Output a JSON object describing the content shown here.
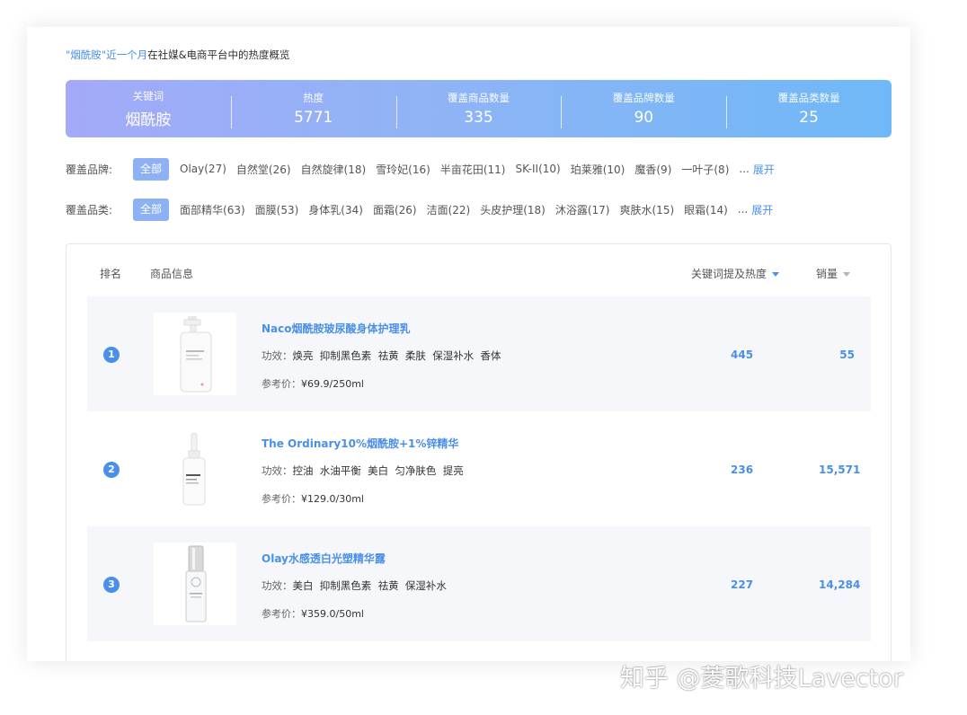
{
  "heading": {
    "keyword": "\"烟酰胺\"近一个月",
    "rest": "在社媒&电商平台中的热度概览"
  },
  "stats": [
    {
      "label": "关键词",
      "value": "烟酰胺"
    },
    {
      "label": "热度",
      "value": "5771"
    },
    {
      "label": "覆盖商品数量",
      "value": "335"
    },
    {
      "label": "覆盖品牌数量",
      "value": "90"
    },
    {
      "label": "覆盖品类数量",
      "value": "25"
    }
  ],
  "brand_filter": {
    "label": "覆盖品牌:",
    "all": "全部",
    "options": [
      "Olay(27)",
      "自然堂(26)",
      "自然旋律(18)",
      "雪玲妃(16)",
      "半亩花田(11)",
      "SK-II(10)",
      "珀莱雅(10)",
      "魔香(9)",
      "一叶子(8)"
    ],
    "ellipsis": "...",
    "expand": "展开"
  },
  "category_filter": {
    "label": "覆盖品类:",
    "all": "全部",
    "options": [
      "面部精华(63)",
      "面膜(53)",
      "身体乳(34)",
      "面霜(26)",
      "洁面(22)",
      "头皮护理(18)",
      "沐浴露(17)",
      "爽肤水(15)",
      "眼霜(14)"
    ],
    "ellipsis": "...",
    "expand": "展开"
  },
  "table": {
    "headers": {
      "rank": "排名",
      "info": "商品信息",
      "heat": "关键词提及热度",
      "sales": "销量"
    },
    "rows": [
      {
        "rank": "1",
        "name": "Naco烟酰胺玻尿酸身体护理乳",
        "effect_label": "功效：",
        "effects": "焕亮  抑制黑色素  祛黄  柔肤  保湿补水  香体",
        "price_label": "参考价：",
        "price": "¥69.9/250ml",
        "heat": "445",
        "sales": "55"
      },
      {
        "rank": "2",
        "name": "The Ordinary10%烟酰胺+1%锌精华",
        "effect_label": "功效：",
        "effects": "控油  水油平衡  美白  匀净肤色  提亮",
        "price_label": "参考价：",
        "price": "¥129.0/30ml",
        "heat": "236",
        "sales": "15,571"
      },
      {
        "rank": "3",
        "name": "Olay水感透白光塑精华露",
        "effect_label": "功效：",
        "effects": "美白  抑制黑色素  祛黄  保湿补水",
        "price_label": "参考价：",
        "price": "¥359.0/50ml",
        "heat": "227",
        "sales": "14,284"
      }
    ]
  },
  "watermark": "知乎 @菱歌科技Lavector",
  "colors": {
    "accent": "#4a8fe8",
    "gradient_start": "#a3aaf8",
    "gradient_end": "#6fb8f7",
    "chip": "#8db1f3"
  }
}
